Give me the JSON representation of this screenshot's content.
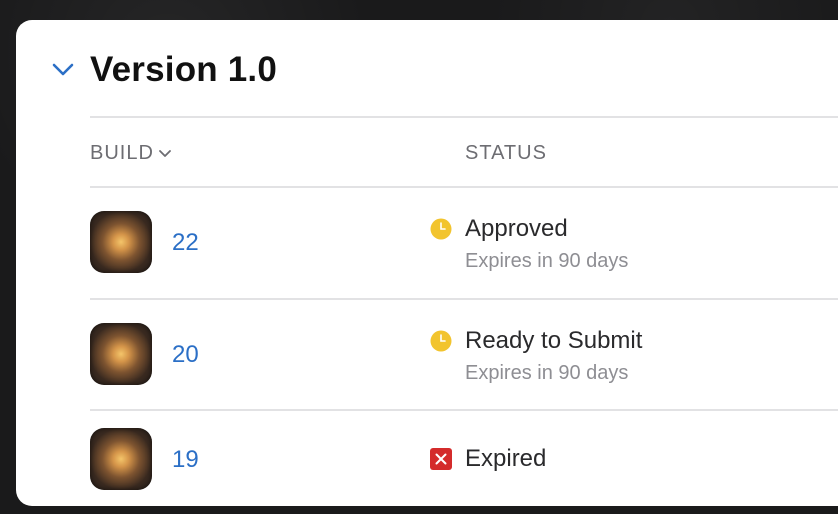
{
  "section": {
    "title": "Version 1.0",
    "expand_icon": "chevron-down-icon"
  },
  "table": {
    "headers": {
      "build": "BUILD",
      "status": "STATUS",
      "sort_icon": "chevron-down-icon"
    },
    "rows": [
      {
        "build": "22",
        "status": "Approved",
        "sub": "Expires in 90 days",
        "status_icon": "clock-icon",
        "status_color": "#f2c42e"
      },
      {
        "build": "20",
        "status": "Ready to Submit",
        "sub": "Expires in 90 days",
        "status_icon": "clock-icon",
        "status_color": "#f2c42e"
      },
      {
        "build": "19",
        "status": "Expired",
        "sub": "",
        "status_icon": "x-mark-icon",
        "status_color": "#d42b2b"
      }
    ]
  },
  "colors": {
    "link": "#2b6fc6",
    "header_text": "#6d6d72",
    "divider": "#e2e2e4"
  }
}
